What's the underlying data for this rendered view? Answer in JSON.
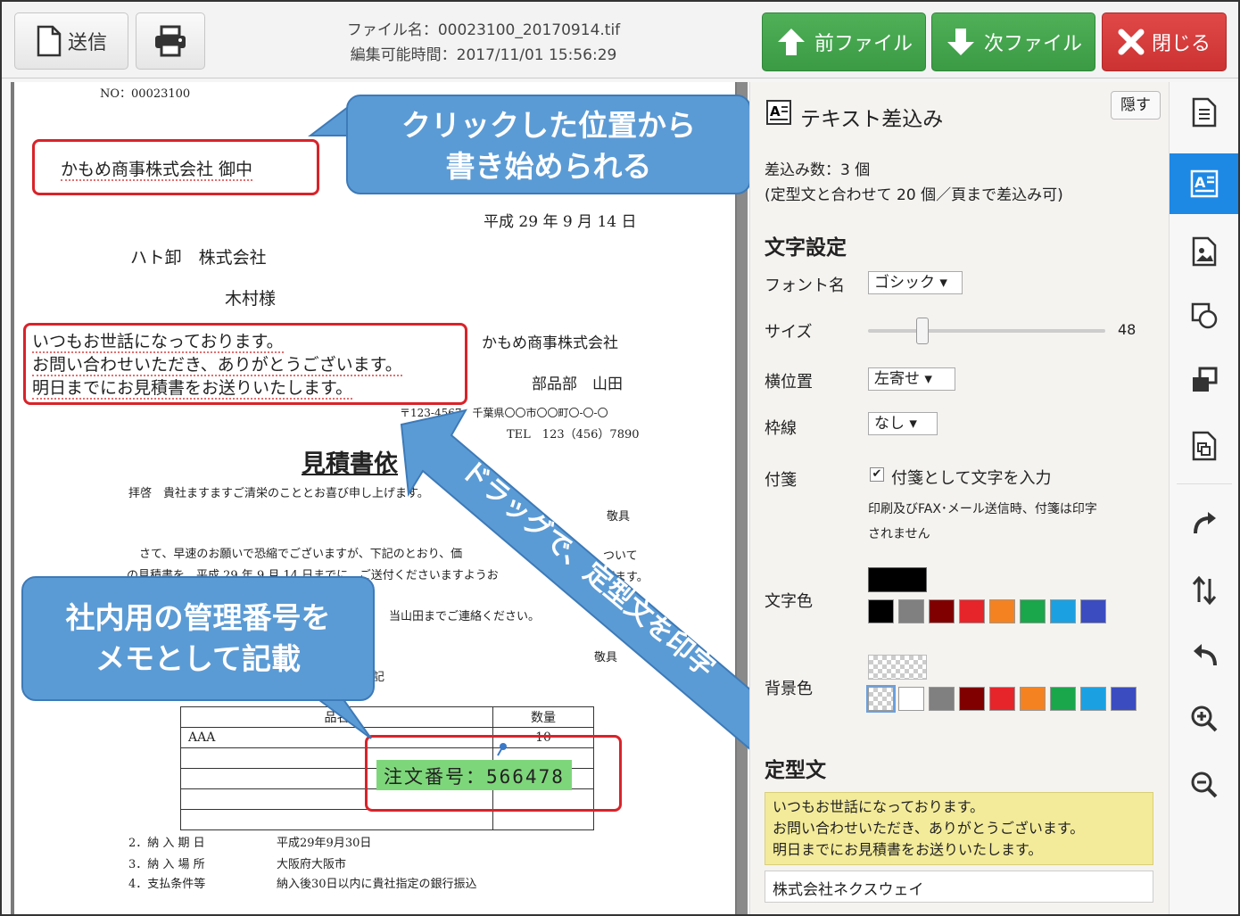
{
  "toolbar": {
    "send_label": "送信",
    "file_name": "ファイル名：00023100_20170914.tif",
    "edit_time": "編集可能時間：2017/11/01 15:56:29",
    "prev_label": "前ファイル",
    "next_label": "次ファイル",
    "close_label": "閉じる"
  },
  "document": {
    "no": "NO：00023100",
    "addressee_inserted": "かもめ商事株式会社 御中",
    "date": "平成 29 年 9 月 14 日",
    "company": "ハト卸　株式会社",
    "person": "木村様",
    "sender_company": "かもめ商事株式会社",
    "sender_dept": "部品部　山田",
    "sender_address": "〒123-4567　千葉県〇〇市〇〇町〇-〇-〇",
    "sender_tel": "TEL　123（456）7890",
    "inserted_lines": [
      "いつもお世話になっております。",
      "お問い合わせいただき、ありがとうございます。",
      "明日までにお見積書をお送りいたします。"
    ],
    "title": "見積書依",
    "greeting": "拝啓　貴社ますますご清栄のこととお喜び申し上げます。",
    "keigu1": "敬具",
    "body1": "さて、早速のお願いで恐縮でございますが、下記のとおり、価",
    "body1_tail": "ついて",
    "body2": "の見積書を、平成 29 年 9 月 14 日までに、ご送付くださいますようお",
    "body2_tail": "げます。",
    "body3": "当山田までご連絡ください。",
    "keigu2": "敬具",
    "ki": "記",
    "table_header_item": "品名",
    "table_header_qty": "数量",
    "table_item": "AAA",
    "table_qty": "10",
    "sticky_note": "注文番号：566478",
    "cond_rows": [
      {
        "label": "2．納 入 期 日",
        "value": "平成29年9月30日"
      },
      {
        "label": "3．納 入 場 所",
        "value": "大阪府大阪市"
      },
      {
        "label": "4．支払条件等",
        "value": "納入後30日以内に貴社指定の銀行振込"
      }
    ]
  },
  "callouts": {
    "click_text": [
      "クリックした位置から",
      "書き始められる"
    ],
    "memo_text": [
      "社内用の管理番号を",
      "メモとして記載"
    ],
    "drag_text": "ドラッグで、定型文を印字"
  },
  "panel": {
    "title": "テキスト差込み",
    "hide_label": "隠す",
    "count_text": "差込み数：3 個",
    "limit_text": "(定型文と合わせて 20 個／頁まで差込み可)",
    "section_text": "文字設定",
    "font_label": "フォント名",
    "font_value": "ゴシック",
    "size_label": "サイズ",
    "size_value": "48",
    "align_label": "横位置",
    "align_value": "左寄せ",
    "border_label": "枠線",
    "border_value": "なし",
    "sticky_label": "付箋",
    "sticky_checkbox_label": "付箋として文字を入力",
    "sticky_note1": "印刷及びFAX･メール送信時、付箋は印字",
    "sticky_note2": "されません",
    "text_color_label": "文字色",
    "bg_color_label": "背景色",
    "template_label": "定型文",
    "template_lines": [
      "いつもお世話になっております。",
      "お問い合わせいただき、ありがとうございます。",
      "明日までにお見積書をお送りいたします。"
    ],
    "template2": "株式会社ネクスウェイ",
    "text_colors": [
      "#000000",
      "#808080",
      "#800000",
      "#e6252b",
      "#f58220",
      "#1aa64b",
      "#1ba1e2",
      "#3b4cc0"
    ],
    "bg_colors": [
      "transparent",
      "#ffffff",
      "#808080",
      "#800000",
      "#e6252b",
      "#f58220",
      "#1aa64b",
      "#1ba1e2",
      "#3b4cc0"
    ]
  },
  "rail_icons": [
    "document-icon",
    "text-insert-icon",
    "image-icon",
    "shape-icon",
    "layer-icon",
    "copy-page-icon",
    "rotate-right-icon",
    "flip-vertical-icon",
    "undo-icon",
    "zoom-in-icon",
    "zoom-out-icon"
  ]
}
